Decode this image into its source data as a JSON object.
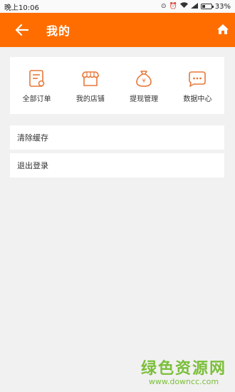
{
  "status": {
    "time": "晚上10:06",
    "battery": "33%",
    "battery_level": 0.33
  },
  "header": {
    "title": "我的"
  },
  "grid": {
    "items": [
      {
        "label": "全部订单",
        "icon": "order-list-icon"
      },
      {
        "label": "我的店铺",
        "icon": "store-icon"
      },
      {
        "label": "提现管理",
        "icon": "money-bag-icon"
      },
      {
        "label": "数据中心",
        "icon": "chat-bubble-icon"
      }
    ]
  },
  "settings": {
    "clear_cache": "清除缓存",
    "logout": "退出登录"
  },
  "watermark": {
    "text": "绿色资源网",
    "url": "www.downcc.com"
  },
  "colors": {
    "accent": "#ff6d00",
    "icon": "#e8783a",
    "background": "#f1f1f1",
    "watermark": "#7bbf3a"
  }
}
